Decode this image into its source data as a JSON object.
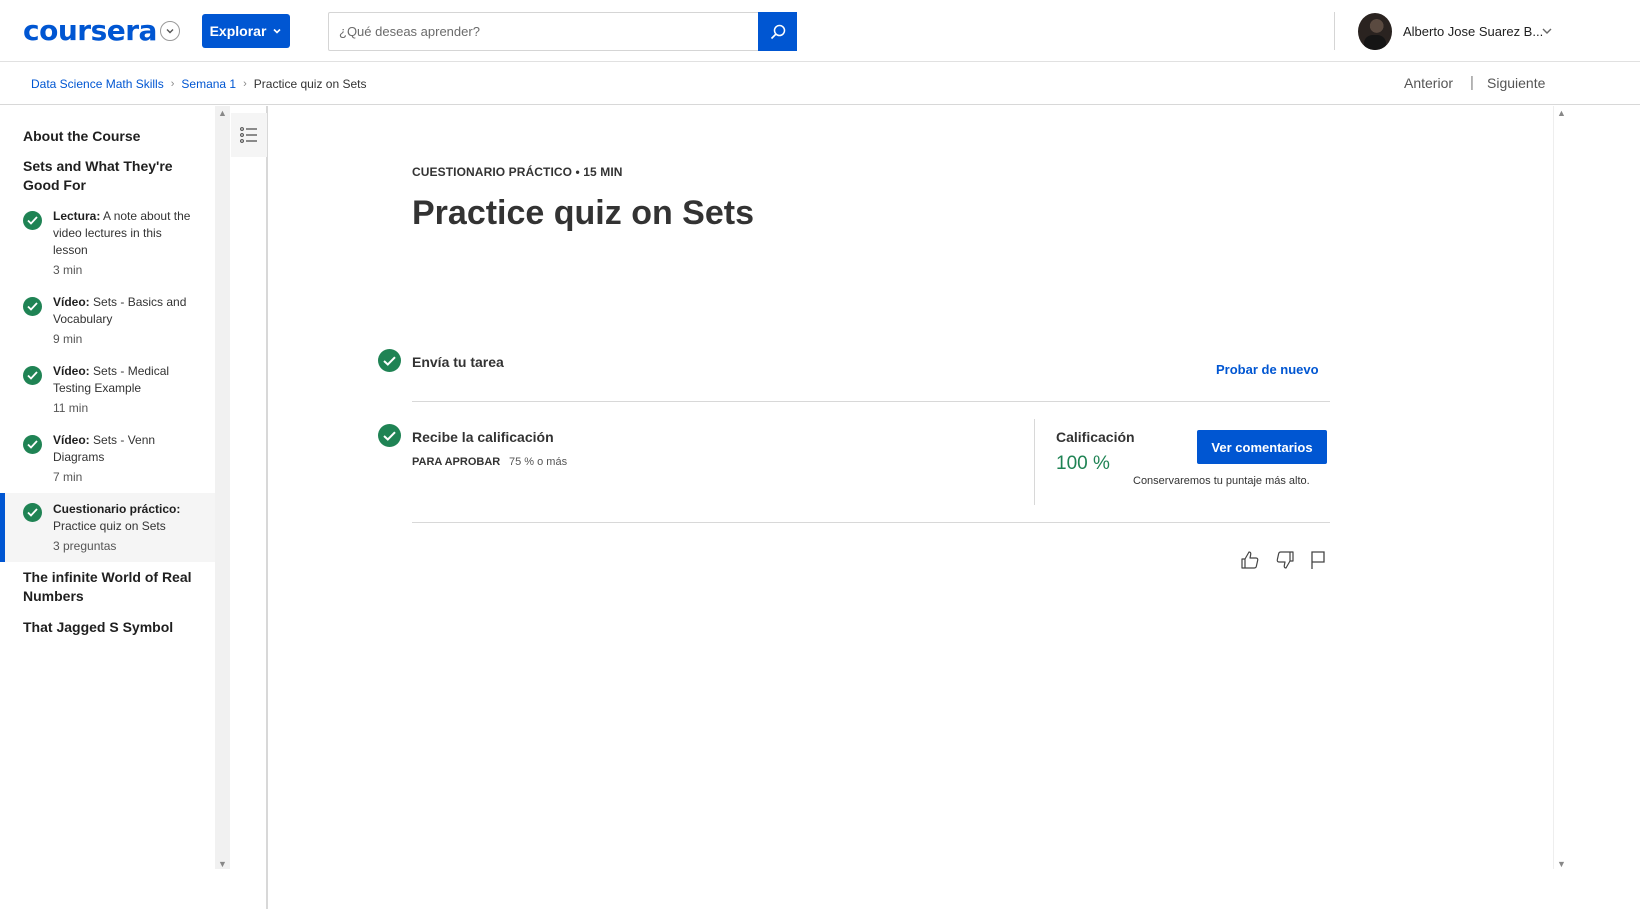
{
  "header": {
    "logo": "coursera",
    "explore_label": "Explorar",
    "search_placeholder": "¿Qué deseas aprender?",
    "user_name": "Alberto Jose Suarez B...",
    "brand_color": "#0056d2"
  },
  "breadcrumb": {
    "items": [
      "Data Science Math Skills",
      "Semana 1"
    ],
    "current": "Practice quiz on Sets"
  },
  "nav": {
    "prev": "Anterior",
    "separator": "|",
    "next": "Siguiente"
  },
  "sidebar": {
    "sections": [
      {
        "title": "About the Course"
      },
      {
        "title": "Sets and What They're Good For"
      },
      {
        "title": "The infinite World of Real Numbers"
      },
      {
        "title": "That Jagged S Symbol"
      }
    ],
    "items": [
      {
        "kind": "Lectura:",
        "name": "A note about the video lectures in this lesson",
        "duration": "3 min"
      },
      {
        "kind": "Vídeo:",
        "name": "Sets - Basics and Vocabulary",
        "duration": "9 min"
      },
      {
        "kind": "Vídeo:",
        "name": "Sets - Medical Testing Example",
        "duration": "11 min"
      },
      {
        "kind": "Vídeo:",
        "name": "Sets - Venn Diagrams",
        "duration": "7 min"
      },
      {
        "kind": "Cuestionario práctico:",
        "name": "Practice quiz on Sets",
        "duration": "3 preguntas"
      }
    ],
    "success_color": "#1f8354"
  },
  "main": {
    "kicker": "CUESTIONARIO PRÁCTICO • 15 MIN",
    "title": "Practice quiz on Sets",
    "submit_step": "Envía tu tarea",
    "retry_label": "Probar de nuevo",
    "grade_step": "Recibe la calificación",
    "pass_label": "PARA APROBAR",
    "pass_value": "75 % o más",
    "grade_label": "Calificación",
    "grade_value": "100 %",
    "feedback_button": "Ver comentarios",
    "keep_note": "Conservaremos tu puntaje más alto."
  }
}
